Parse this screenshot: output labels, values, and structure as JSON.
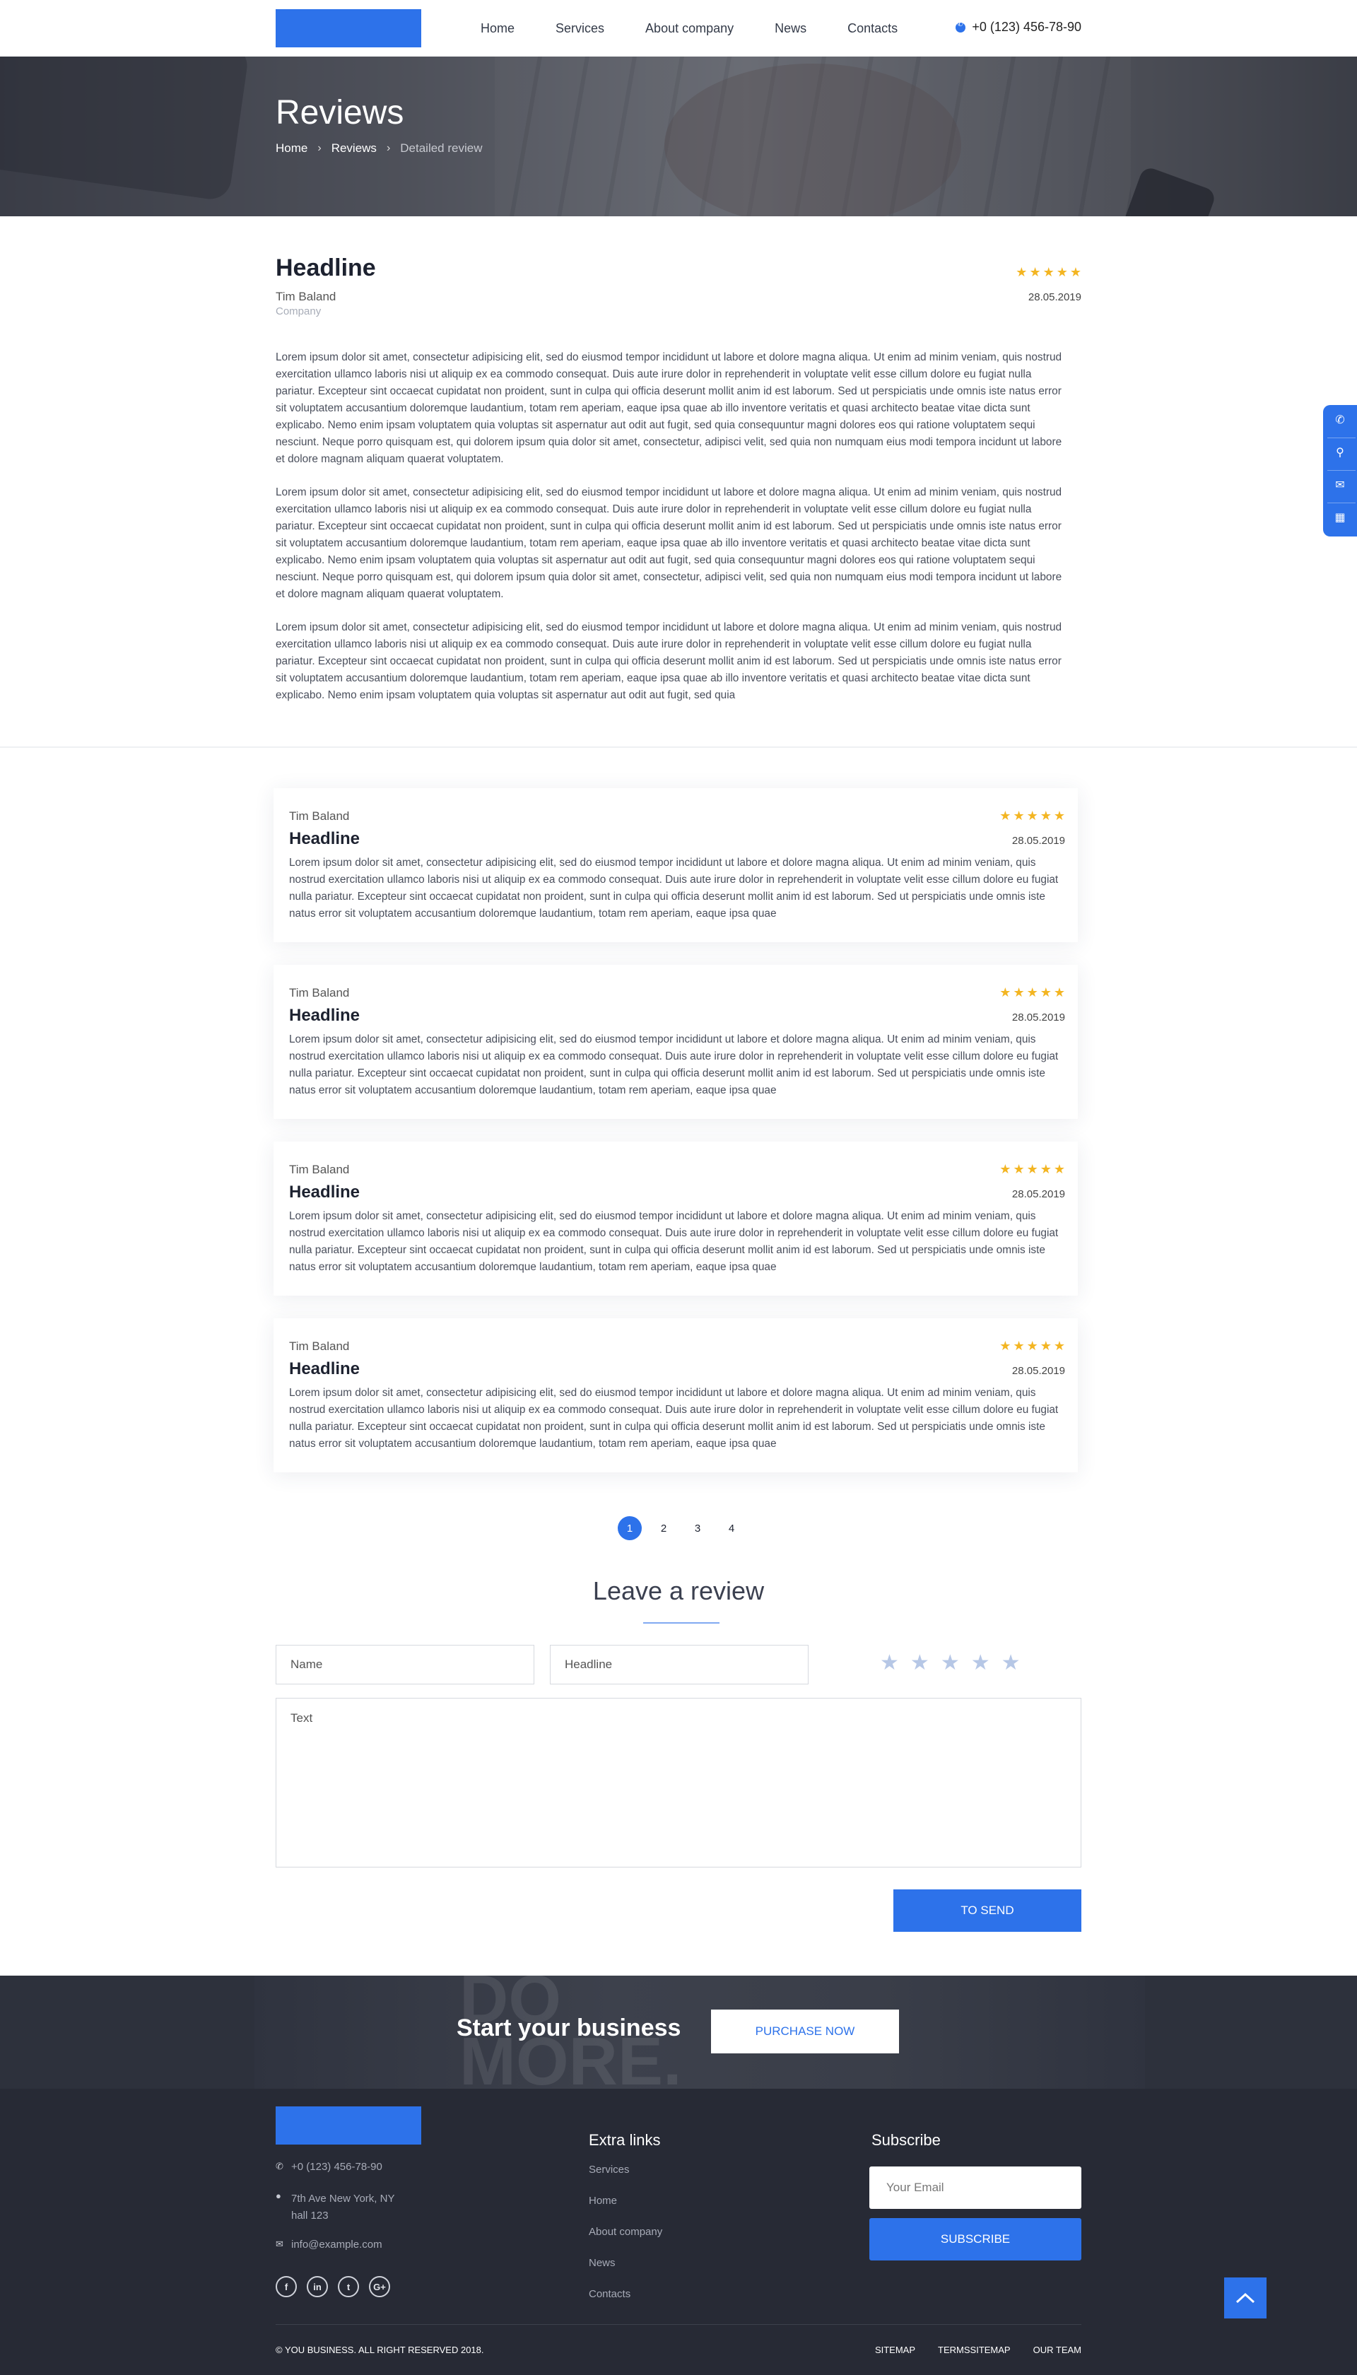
{
  "header": {
    "nav": [
      "Home",
      "Services",
      "About company",
      "News",
      "Contacts"
    ],
    "phone": "+0 (123) 456-78-90"
  },
  "banner": {
    "title": "Reviews",
    "breadcrumb": [
      "Home",
      "Reviews",
      "Detailed review"
    ]
  },
  "review": {
    "headline": "Headline",
    "author": "Tim Baland",
    "company": "Company",
    "date": "28.05.2019",
    "rating": 5,
    "paragraphs": [
      "Lorem ipsum dolor sit amet, consectetur adipisicing elit, sed do eiusmod tempor incididunt ut labore et dolore magna aliqua. Ut enim ad minim veniam, quis nostrud exercitation ullamco laboris nisi ut aliquip ex ea commodo consequat. Duis aute irure dolor in reprehenderit in voluptate velit esse cillum dolore eu fugiat nulla pariatur. Excepteur sint occaecat cupidatat non proident, sunt in culpa qui officia deserunt mollit anim id est laborum. Sed ut perspiciatis unde omnis iste natus error sit voluptatem accusantium doloremque laudantium, totam rem aperiam, eaque ipsa quae ab illo inventore veritatis et quasi architecto beatae vitae dicta sunt explicabo. Nemo enim ipsam voluptatem quia voluptas sit aspernatur aut odit aut fugit, sed quia consequuntur magni dolores eos qui ratione voluptatem sequi nesciunt. Neque porro quisquam est, qui dolorem ipsum quia dolor sit amet, consectetur, adipisci velit, sed quia non numquam eius modi tempora incidunt ut labore et dolore magnam aliquam quaerat voluptatem.",
      "Lorem ipsum dolor sit amet, consectetur adipisicing elit, sed do eiusmod tempor incididunt ut labore et dolore magna aliqua. Ut enim ad minim veniam, quis nostrud exercitation ullamco laboris nisi ut aliquip ex ea commodo consequat. Duis aute irure dolor in reprehenderit in voluptate velit esse cillum dolore eu fugiat nulla pariatur. Excepteur sint occaecat cupidatat non proident, sunt in culpa qui officia deserunt mollit anim id est laborum. Sed ut perspiciatis unde omnis iste natus error sit voluptatem accusantium doloremque laudantium, totam rem aperiam, eaque ipsa quae ab illo inventore veritatis et quasi architecto beatae vitae dicta sunt explicabo. Nemo enim ipsam voluptatem quia voluptas sit aspernatur aut odit aut fugit, sed quia consequuntur magni dolores eos qui ratione voluptatem sequi nesciunt. Neque porro quisquam est, qui dolorem ipsum quia dolor sit amet, consectetur, adipisci velit, sed quia non numquam eius modi tempora incidunt ut labore et dolore magnam aliquam quaerat voluptatem.",
      "Lorem ipsum dolor sit amet, consectetur adipisicing elit, sed do eiusmod tempor incididunt ut labore et dolore magna aliqua. Ut enim ad minim veniam, quis nostrud exercitation ullamco laboris nisi ut aliquip ex ea commodo consequat. Duis aute irure dolor in reprehenderit in voluptate velit esse cillum dolore eu fugiat nulla pariatur. Excepteur sint occaecat cupidatat non proident, sunt in culpa qui officia deserunt mollit anim id est laborum. Sed ut perspiciatis unde omnis iste natus error sit voluptatem accusantium doloremque laudantium, totam rem aperiam, eaque ipsa quae ab illo inventore veritatis et quasi architecto beatae vitae dicta sunt explicabo. Nemo enim ipsam voluptatem quia voluptas sit aspernatur aut odit aut fugit, sed quia"
    ]
  },
  "cards": [
    {
      "author": "Tim Baland",
      "headline": "Headline",
      "date": "28.05.2019",
      "rating": 5,
      "text": "Lorem ipsum dolor sit amet, consectetur adipisicing elit, sed do eiusmod tempor incididunt ut labore et dolore magna aliqua. Ut enim ad minim veniam, quis nostrud exercitation ullamco laboris nisi ut aliquip ex ea commodo consequat. Duis aute irure dolor in reprehenderit in voluptate velit esse cillum dolore eu fugiat nulla pariatur. Excepteur sint occaecat cupidatat non proident, sunt in culpa qui officia deserunt mollit anim id est laborum. Sed ut perspiciatis unde omnis iste natus error sit voluptatem accusantium doloremque laudantium, totam rem aperiam, eaque ipsa quae"
    },
    {
      "author": "Tim Baland",
      "headline": "Headline",
      "date": "28.05.2019",
      "rating": 5,
      "text": "Lorem ipsum dolor sit amet, consectetur adipisicing elit, sed do eiusmod tempor incididunt ut labore et dolore magna aliqua. Ut enim ad minim veniam, quis nostrud exercitation ullamco laboris nisi ut aliquip ex ea commodo consequat. Duis aute irure dolor in reprehenderit in voluptate velit esse cillum dolore eu fugiat nulla pariatur. Excepteur sint occaecat cupidatat non proident, sunt in culpa qui officia deserunt mollit anim id est laborum. Sed ut perspiciatis unde omnis iste natus error sit voluptatem accusantium doloremque laudantium, totam rem aperiam, eaque ipsa quae"
    },
    {
      "author": "Tim Baland",
      "headline": "Headline",
      "date": "28.05.2019",
      "rating": 5,
      "text": "Lorem ipsum dolor sit amet, consectetur adipisicing elit, sed do eiusmod tempor incididunt ut labore et dolore magna aliqua. Ut enim ad minim veniam, quis nostrud exercitation ullamco laboris nisi ut aliquip ex ea commodo consequat. Duis aute irure dolor in reprehenderit in voluptate velit esse cillum dolore eu fugiat nulla pariatur. Excepteur sint occaecat cupidatat non proident, sunt in culpa qui officia deserunt mollit anim id est laborum. Sed ut perspiciatis unde omnis iste natus error sit voluptatem accusantium doloremque laudantium, totam rem aperiam, eaque ipsa quae"
    },
    {
      "author": "Tim Baland",
      "headline": "Headline",
      "date": "28.05.2019",
      "rating": 5,
      "text": "Lorem ipsum dolor sit amet, consectetur adipisicing elit, sed do eiusmod tempor incididunt ut labore et dolore magna aliqua. Ut enim ad minim veniam, quis nostrud exercitation ullamco laboris nisi ut aliquip ex ea commodo consequat. Duis aute irure dolor in reprehenderit in voluptate velit esse cillum dolore eu fugiat nulla pariatur. Excepteur sint occaecat cupidatat non proident, sunt in culpa qui officia deserunt mollit anim id est laborum. Sed ut perspiciatis unde omnis iste natus error sit voluptatem accusantium doloremque laudantium, totam rem aperiam, eaque ipsa quae"
    }
  ],
  "pagination": {
    "pages": [
      "1",
      "2",
      "3",
      "4"
    ],
    "current": "1"
  },
  "form": {
    "title": "Leave a review",
    "name_placeholder": "Name",
    "headline_placeholder": "Headline",
    "text_placeholder": "Text",
    "submit_label": "TO SEND"
  },
  "cta": {
    "watermark": [
      "DO",
      "MORE."
    ],
    "title": "Start your business",
    "button": "PURCHASE NOW"
  },
  "footer": {
    "phone": "+0 (123) 456-78-90",
    "address_line1": "7th Ave New York, NY",
    "address_line2": "hall 123",
    "email": "info@example.com",
    "social": [
      "f",
      "in",
      "t",
      "G+"
    ],
    "links_title": "Extra links",
    "links": [
      "Services",
      "Home",
      "About company",
      "News",
      "Contacts"
    ],
    "subscribe_title": "Subscribe",
    "email_placeholder": "Your Email",
    "subscribe_button": "SUBSCRIBE",
    "copyright": "© YOU BUSINESS. ALL RIGHT RESERVED 2018.",
    "bottom_links": [
      "SITEMAP",
      "TERMSSITEMAP",
      "OUR TEAM"
    ]
  },
  "colors": {
    "accent": "#2d72ea",
    "star": "#f3b522",
    "footer_bg": "#272a35"
  },
  "icons": {
    "side_widget": [
      "phone-icon",
      "map-pin-icon",
      "chat-icon",
      "basket-icon"
    ],
    "to_top": "chevron-up-icon"
  }
}
